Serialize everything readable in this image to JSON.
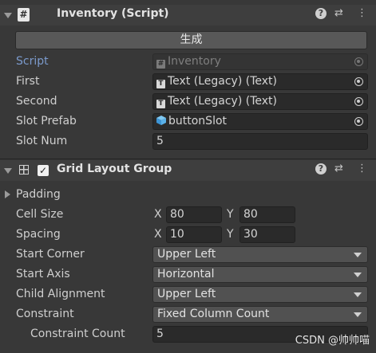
{
  "inventory": {
    "title": "Inventory (Script)",
    "generate_label": "生成",
    "script_label": "Script",
    "script_value": "Inventory",
    "first_label": "First",
    "first_value": "Text (Legacy) (Text)",
    "second_label": "Second",
    "second_value": "Text (Legacy) (Text)",
    "slot_prefab_label": "Slot Prefab",
    "slot_prefab_value": "buttonSlot",
    "slot_num_label": "Slot Num",
    "slot_num_value": "5"
  },
  "grid": {
    "title": "Grid Layout Group",
    "enabled_glyph": "✓",
    "padding_label": "Padding",
    "cell_size_label": "Cell Size",
    "cell_x": "80",
    "cell_y": "80",
    "spacing_label": "Spacing",
    "spacing_x": "10",
    "spacing_y": "30",
    "x_label": "X",
    "y_label": "Y",
    "start_corner_label": "Start Corner",
    "start_corner_value": "Upper Left",
    "start_axis_label": "Start Axis",
    "start_axis_value": "Horizontal",
    "child_alignment_label": "Child Alignment",
    "child_alignment_value": "Upper Left",
    "constraint_label": "Constraint",
    "constraint_value": "Fixed Column Count",
    "constraint_count_label": "Constraint Count",
    "constraint_count_value": "5"
  },
  "header_icons": {
    "help": "?",
    "presets": "⇄",
    "more": "⋮"
  },
  "watermark": "CSDN @帅帅喵"
}
